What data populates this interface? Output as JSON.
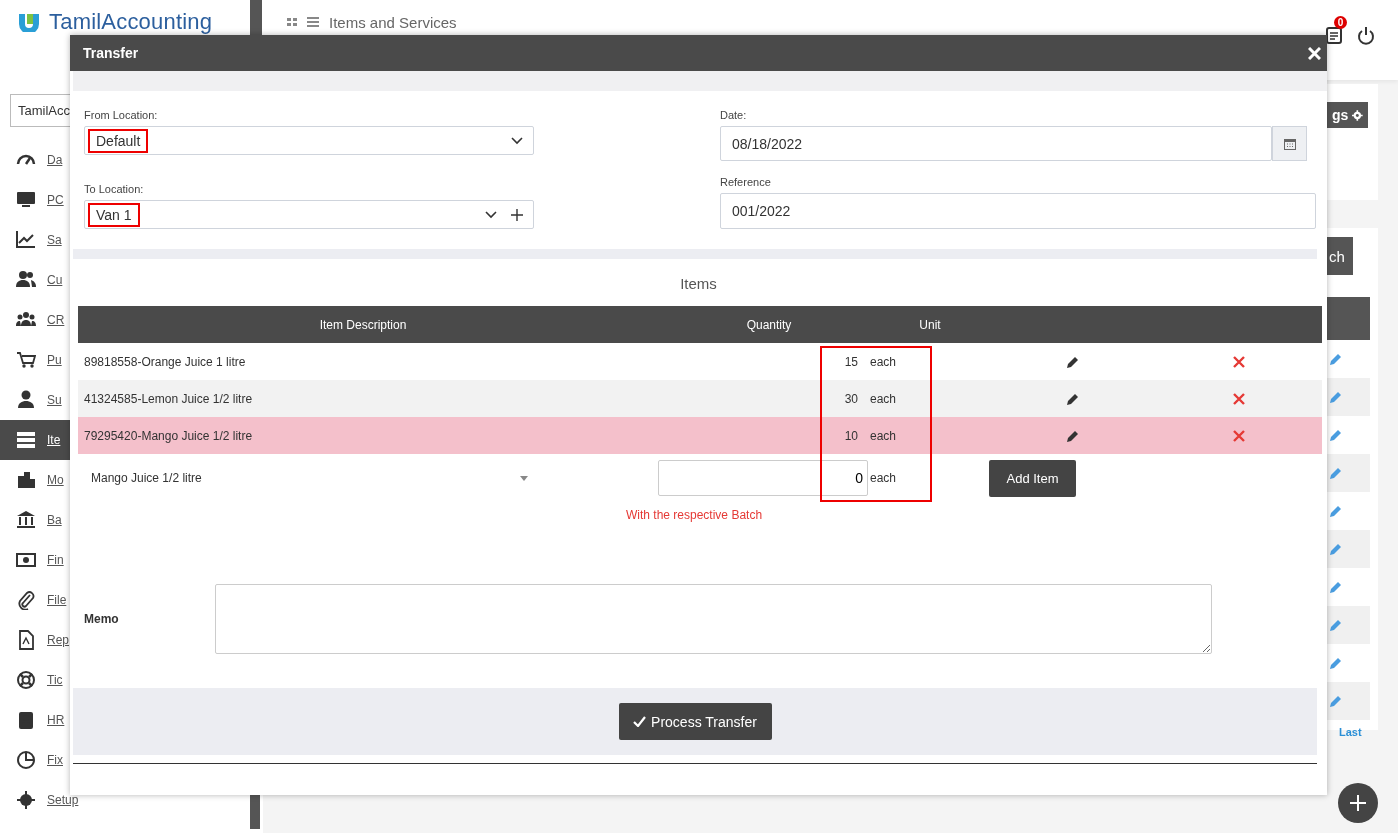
{
  "app": {
    "logo": "TamilAccounting",
    "company_select": "TamilAcc"
  },
  "sidebar": {
    "items": [
      {
        "label": "Da",
        "selected": false
      },
      {
        "label": "PC",
        "selected": false
      },
      {
        "label": "Sa",
        "selected": false
      },
      {
        "label": "Cu",
        "selected": false
      },
      {
        "label": "CR",
        "selected": false
      },
      {
        "label": "Pu",
        "selected": false
      },
      {
        "label": "Su",
        "selected": false
      },
      {
        "label": "Ite",
        "selected": true
      },
      {
        "label": "Mo",
        "selected": false
      },
      {
        "label": "Ba",
        "selected": false
      },
      {
        "label": "Fin",
        "selected": false
      },
      {
        "label": "File",
        "selected": false
      },
      {
        "label": "Rep",
        "selected": false
      },
      {
        "label": "Tic",
        "selected": false
      },
      {
        "label": "HR",
        "selected": false
      },
      {
        "label": "Fix",
        "selected": false
      },
      {
        "label": "Setup",
        "selected": false
      }
    ]
  },
  "header": {
    "title": "Items and Services",
    "notification_count": "0"
  },
  "background": {
    "settings_button": "gs",
    "search_button": "ch",
    "pager_link": "Last"
  },
  "modal": {
    "title": "Transfer",
    "from_location": {
      "label": "From Location:",
      "value": "Default",
      "highlighted": true
    },
    "to_location": {
      "label": "To Location:",
      "value": "Van 1",
      "highlighted": true
    },
    "date": {
      "label": "Date:",
      "value": "08/18/2022"
    },
    "reference": {
      "label": "Reference",
      "value": "001/2022"
    },
    "items": {
      "title": "Items",
      "columns": [
        "Item Description",
        "Quantity",
        "Unit"
      ],
      "rows": [
        {
          "description": "89818558-Orange Juice 1 litre",
          "quantity": "15",
          "unit": "each",
          "selected": false
        },
        {
          "description": "41324585-Lemon Juice 1/2 litre",
          "quantity": "30",
          "unit": "each",
          "selected": false
        },
        {
          "description": "79295420-Mango Juice 1/2 litre",
          "quantity": "10",
          "unit": "each",
          "selected": true
        }
      ],
      "highlight_quantity_unit": true,
      "new_item": {
        "item": "Mango Juice 1/2 litre",
        "quantity": "0",
        "unit": "each",
        "button": "Add Item"
      },
      "note": "With the respective Batch"
    },
    "memo": {
      "label": "Memo"
    },
    "submit_button": "Process Transfer"
  }
}
